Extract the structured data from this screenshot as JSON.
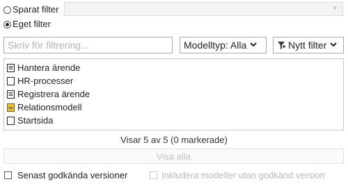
{
  "filter_mode": {
    "saved_label": "Sparat filter",
    "custom_label": "Eget filter",
    "selected": "custom"
  },
  "saved_filter_select": {
    "value": ""
  },
  "filter_input": {
    "placeholder": "Skriv för filtrering...",
    "value": ""
  },
  "model_type_button": {
    "label": "Modelltyp: Alla"
  },
  "new_filter_button": {
    "label": "Nytt filter"
  },
  "models": [
    {
      "label": "Hantera ärende",
      "icon": "document-lines-icon"
    },
    {
      "label": "HR-processer",
      "icon": "document-icon"
    },
    {
      "label": "Registrera ärende",
      "icon": "document-lines-icon"
    },
    {
      "label": "Relationsmodell",
      "icon": "folder-document-icon"
    },
    {
      "label": "Startsida",
      "icon": "document-icon"
    }
  ],
  "status": {
    "text": "Visar 5 av 5 (0 markerade)"
  },
  "show_all_button": {
    "label": "Visa alla"
  },
  "options": {
    "latest_approved": {
      "label": "Senast godkända versioner",
      "checked": false
    },
    "include_unapproved": {
      "label": "Inkludera modeller utan godkänd version",
      "checked": false,
      "disabled": true
    }
  },
  "colors": {
    "border": "#a9a9a9",
    "folder_yellow": "#f2c230",
    "disabled_text": "#b8b8b8"
  }
}
